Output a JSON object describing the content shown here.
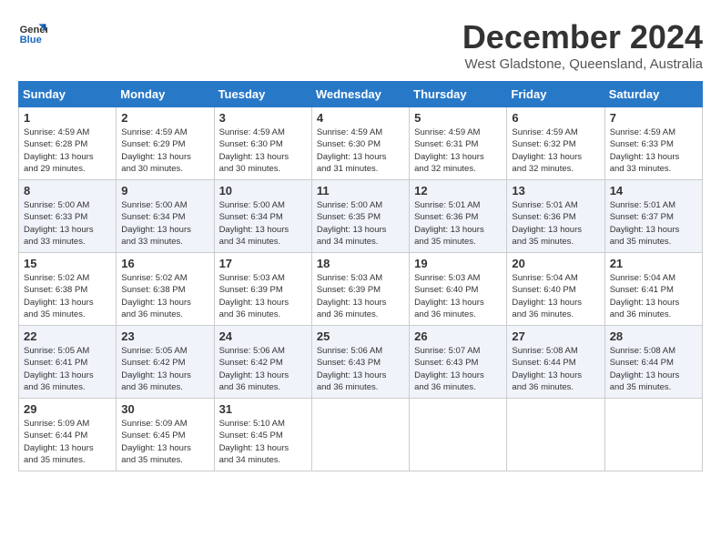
{
  "logo": {
    "line1": "General",
    "line2": "Blue"
  },
  "title": "December 2024",
  "subtitle": "West Gladstone, Queensland, Australia",
  "days_of_week": [
    "Sunday",
    "Monday",
    "Tuesday",
    "Wednesday",
    "Thursday",
    "Friday",
    "Saturday"
  ],
  "weeks": [
    [
      {
        "day": "1",
        "sunrise": "4:59 AM",
        "sunset": "6:28 PM",
        "daylight": "13 hours and 29 minutes."
      },
      {
        "day": "2",
        "sunrise": "4:59 AM",
        "sunset": "6:29 PM",
        "daylight": "13 hours and 30 minutes."
      },
      {
        "day": "3",
        "sunrise": "4:59 AM",
        "sunset": "6:30 PM",
        "daylight": "13 hours and 30 minutes."
      },
      {
        "day": "4",
        "sunrise": "4:59 AM",
        "sunset": "6:30 PM",
        "daylight": "13 hours and 31 minutes."
      },
      {
        "day": "5",
        "sunrise": "4:59 AM",
        "sunset": "6:31 PM",
        "daylight": "13 hours and 32 minutes."
      },
      {
        "day": "6",
        "sunrise": "4:59 AM",
        "sunset": "6:32 PM",
        "daylight": "13 hours and 32 minutes."
      },
      {
        "day": "7",
        "sunrise": "4:59 AM",
        "sunset": "6:33 PM",
        "daylight": "13 hours and 33 minutes."
      }
    ],
    [
      {
        "day": "8",
        "sunrise": "5:00 AM",
        "sunset": "6:33 PM",
        "daylight": "13 hours and 33 minutes."
      },
      {
        "day": "9",
        "sunrise": "5:00 AM",
        "sunset": "6:34 PM",
        "daylight": "13 hours and 33 minutes."
      },
      {
        "day": "10",
        "sunrise": "5:00 AM",
        "sunset": "6:34 PM",
        "daylight": "13 hours and 34 minutes."
      },
      {
        "day": "11",
        "sunrise": "5:00 AM",
        "sunset": "6:35 PM",
        "daylight": "13 hours and 34 minutes."
      },
      {
        "day": "12",
        "sunrise": "5:01 AM",
        "sunset": "6:36 PM",
        "daylight": "13 hours and 35 minutes."
      },
      {
        "day": "13",
        "sunrise": "5:01 AM",
        "sunset": "6:36 PM",
        "daylight": "13 hours and 35 minutes."
      },
      {
        "day": "14",
        "sunrise": "5:01 AM",
        "sunset": "6:37 PM",
        "daylight": "13 hours and 35 minutes."
      }
    ],
    [
      {
        "day": "15",
        "sunrise": "5:02 AM",
        "sunset": "6:38 PM",
        "daylight": "13 hours and 35 minutes."
      },
      {
        "day": "16",
        "sunrise": "5:02 AM",
        "sunset": "6:38 PM",
        "daylight": "13 hours and 36 minutes."
      },
      {
        "day": "17",
        "sunrise": "5:03 AM",
        "sunset": "6:39 PM",
        "daylight": "13 hours and 36 minutes."
      },
      {
        "day": "18",
        "sunrise": "5:03 AM",
        "sunset": "6:39 PM",
        "daylight": "13 hours and 36 minutes."
      },
      {
        "day": "19",
        "sunrise": "5:03 AM",
        "sunset": "6:40 PM",
        "daylight": "13 hours and 36 minutes."
      },
      {
        "day": "20",
        "sunrise": "5:04 AM",
        "sunset": "6:40 PM",
        "daylight": "13 hours and 36 minutes."
      },
      {
        "day": "21",
        "sunrise": "5:04 AM",
        "sunset": "6:41 PM",
        "daylight": "13 hours and 36 minutes."
      }
    ],
    [
      {
        "day": "22",
        "sunrise": "5:05 AM",
        "sunset": "6:41 PM",
        "daylight": "13 hours and 36 minutes."
      },
      {
        "day": "23",
        "sunrise": "5:05 AM",
        "sunset": "6:42 PM",
        "daylight": "13 hours and 36 minutes."
      },
      {
        "day": "24",
        "sunrise": "5:06 AM",
        "sunset": "6:42 PM",
        "daylight": "13 hours and 36 minutes."
      },
      {
        "day": "25",
        "sunrise": "5:06 AM",
        "sunset": "6:43 PM",
        "daylight": "13 hours and 36 minutes."
      },
      {
        "day": "26",
        "sunrise": "5:07 AM",
        "sunset": "6:43 PM",
        "daylight": "13 hours and 36 minutes."
      },
      {
        "day": "27",
        "sunrise": "5:08 AM",
        "sunset": "6:44 PM",
        "daylight": "13 hours and 36 minutes."
      },
      {
        "day": "28",
        "sunrise": "5:08 AM",
        "sunset": "6:44 PM",
        "daylight": "13 hours and 35 minutes."
      }
    ],
    [
      {
        "day": "29",
        "sunrise": "5:09 AM",
        "sunset": "6:44 PM",
        "daylight": "13 hours and 35 minutes."
      },
      {
        "day": "30",
        "sunrise": "5:09 AM",
        "sunset": "6:45 PM",
        "daylight": "13 hours and 35 minutes."
      },
      {
        "day": "31",
        "sunrise": "5:10 AM",
        "sunset": "6:45 PM",
        "daylight": "13 hours and 34 minutes."
      },
      null,
      null,
      null,
      null
    ]
  ]
}
